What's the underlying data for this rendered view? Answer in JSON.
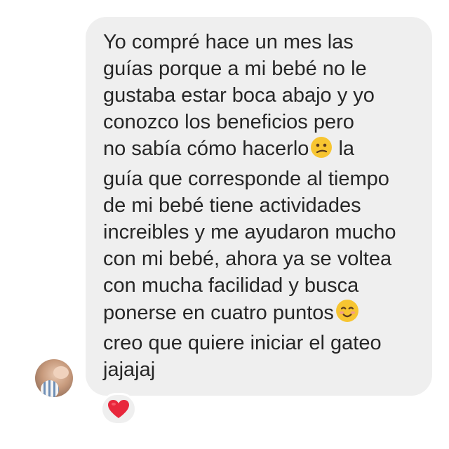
{
  "message": {
    "lines": [
      "Yo compré hace un mes las",
      "guías porque a mi bebé no le",
      "gustaba estar boca abajo y yo",
      "conozco los beneficios pero",
      "no sabía cómo hacerlo",
      " la",
      "guía que corresponde al tiempo",
      "de mi bebé tiene actividades",
      "increibles y me ayudaron mucho",
      "con mi bebé, ahora ya se voltea",
      "con mucha facilidad y busca",
      "ponerse en cuatro puntos",
      "creo que quiere iniciar el gateo",
      "jajajaj"
    ],
    "emojis": [
      "confused-face-emoji",
      "smiling-face-emoji"
    ]
  },
  "reaction": {
    "icon": "heart-icon",
    "color": "#e8273c"
  },
  "colors": {
    "bubble": "#efefef",
    "text": "#262626",
    "background": "#ffffff"
  }
}
